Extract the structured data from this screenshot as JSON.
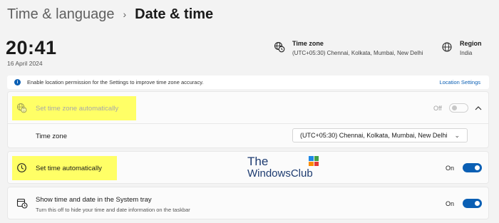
{
  "breadcrumb": {
    "parent": "Time & language",
    "separator": "›",
    "current": "Date & time"
  },
  "clock": {
    "time": "20:41",
    "date": "16 April 2024"
  },
  "time_zone_info": {
    "title": "Time zone",
    "value": "(UTC+05:30) Chennai, Kolkata, Mumbai, New Delhi",
    "icon": "globe-clock-icon"
  },
  "region_info": {
    "title": "Region",
    "value": "India",
    "icon": "globe-icon"
  },
  "banner": {
    "icon": "info-icon",
    "text": "Enable location permission for the Settings to improve time zone accuracy.",
    "link": "Location Settings"
  },
  "settings": {
    "set_tz_auto": {
      "label": "Set time zone automatically",
      "state": "Off",
      "enabled": false,
      "expanded": true,
      "icon": "globe-sync-icon"
    },
    "time_zone_select": {
      "label": "Time zone",
      "value": "(UTC+05:30) Chennai, Kolkata, Mumbai, New Delhi"
    },
    "set_time_auto": {
      "label": "Set time automatically",
      "state": "On",
      "icon": "clock-icon"
    },
    "show_in_tray": {
      "label": "Show time and date in the System tray",
      "description": "Turn this off to hide your time and date information on the taskbar",
      "state": "On",
      "icon": "calendar-clock-icon"
    }
  },
  "watermark": {
    "line1": "The",
    "line2": "WindowsClub"
  },
  "colors": {
    "accent": "#0a5fb4",
    "highlight": "#ffff66",
    "background": "#f3f3f3"
  }
}
